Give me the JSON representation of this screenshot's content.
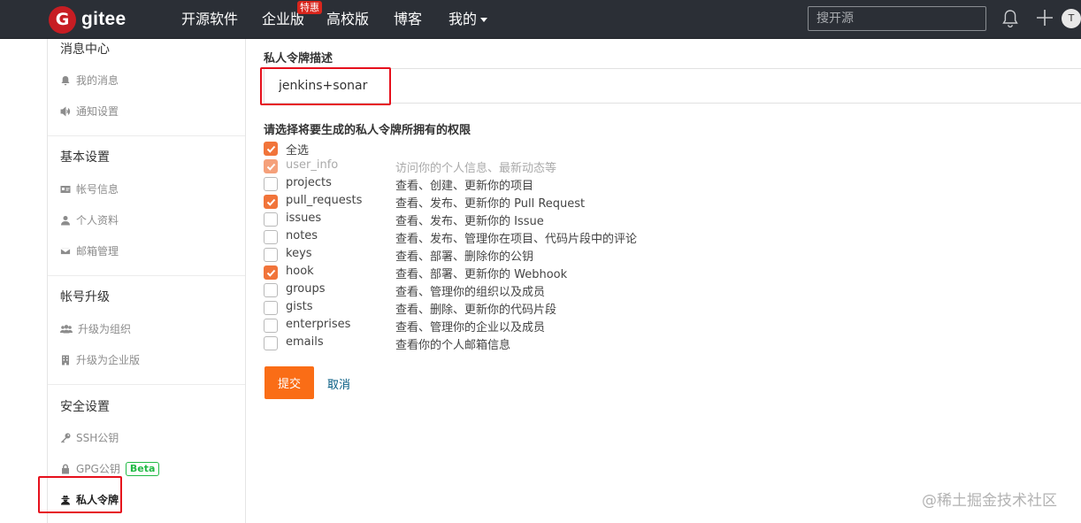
{
  "nav": {
    "logo_mark": "G",
    "logo_text": "gitee",
    "items": [
      "开源软件",
      "企业版",
      "高校版",
      "博客",
      "我的"
    ],
    "badge": "特惠",
    "search_placeholder": "搜开源",
    "avatar": "T"
  },
  "sidebar": {
    "groups": [
      {
        "title": "消息中心",
        "items": [
          {
            "label": "我的消息",
            "icon": "bell-icon"
          },
          {
            "label": "通知设置",
            "icon": "speaker-icon"
          }
        ]
      },
      {
        "title": "基本设置",
        "items": [
          {
            "label": "帐号信息",
            "icon": "id-card-icon"
          },
          {
            "label": "个人资料",
            "icon": "user-icon"
          },
          {
            "label": "邮箱管理",
            "icon": "envelope-icon"
          }
        ]
      },
      {
        "title": "帐号升级",
        "items": [
          {
            "label": "升级为组织",
            "icon": "users-icon"
          },
          {
            "label": "升级为企业版",
            "icon": "building-icon"
          }
        ]
      },
      {
        "title": "安全设置",
        "items": [
          {
            "label": "SSH公钥",
            "icon": "key-icon"
          },
          {
            "label": "GPG公钥",
            "icon": "lock-icon",
            "badge": "Beta"
          },
          {
            "label": "私人令牌",
            "icon": "user-secret-icon",
            "active": true
          }
        ]
      }
    ]
  },
  "form": {
    "desc_label": "私人令牌描述",
    "desc_value": "jenkins+sonar",
    "perm_label": "请选择将要生成的私人令牌所拥有的权限",
    "select_all": {
      "label": "全选",
      "checked": true
    },
    "permissions": [
      {
        "name": "user_info",
        "desc": "访问你的个人信息、最新动态等",
        "checked": true,
        "disabled": true
      },
      {
        "name": "projects",
        "desc": "查看、创建、更新你的项目",
        "checked": false
      },
      {
        "name": "pull_requests",
        "desc": "查看、发布、更新你的 Pull Request",
        "checked": true
      },
      {
        "name": "issues",
        "desc": "查看、发布、更新你的 Issue",
        "checked": false
      },
      {
        "name": "notes",
        "desc": "查看、发布、管理你在项目、代码片段中的评论",
        "checked": false
      },
      {
        "name": "keys",
        "desc": "查看、部署、删除你的公钥",
        "checked": false
      },
      {
        "name": "hook",
        "desc": "查看、部署、更新你的 Webhook",
        "checked": true
      },
      {
        "name": "groups",
        "desc": "查看、管理你的组织以及成员",
        "checked": false
      },
      {
        "name": "gists",
        "desc": "查看、删除、更新你的代码片段",
        "checked": false
      },
      {
        "name": "enterprises",
        "desc": "查看、管理你的企业以及成员",
        "checked": false
      },
      {
        "name": "emails",
        "desc": "查看你的个人邮箱信息",
        "checked": false
      }
    ],
    "submit": "提交",
    "cancel": "取消"
  },
  "watermark": "@稀土掘金技术社区",
  "colors": {
    "accent": "#fa6d16",
    "checkbox": "#f1743a",
    "nav_bg": "#2b2f36",
    "highlight": "#e6101c",
    "brand": "#c71d23"
  }
}
